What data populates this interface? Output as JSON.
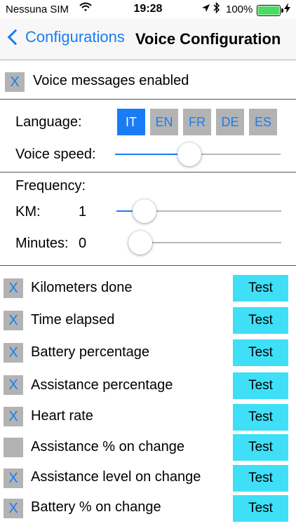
{
  "status_bar": {
    "carrier": "Nessuna SIM",
    "time": "19:28",
    "battery_percent": "100%",
    "battery_level": 1.0
  },
  "nav": {
    "back_label": "Configurations",
    "title": "Voice Configuration"
  },
  "voice_enabled": {
    "label": "Voice messages enabled",
    "checked": true,
    "mark": "X"
  },
  "language": {
    "label": "Language:",
    "options": [
      "IT",
      "EN",
      "FR",
      "DE",
      "ES"
    ],
    "selected": "IT"
  },
  "voice_speed": {
    "label": "Voice speed:",
    "value": 0.45
  },
  "frequency": {
    "label": "Frequency:",
    "km": {
      "label": "KM:",
      "value": "1",
      "slider_value": 0.17
    },
    "minutes": {
      "label": "Minutes:",
      "value": "0",
      "slider_value": 0.0
    }
  },
  "messages": [
    {
      "label": "Kilometers done",
      "checked": true,
      "mark": "X",
      "test_label": "Test"
    },
    {
      "label": "Time elapsed",
      "checked": true,
      "mark": "X",
      "test_label": "Test"
    },
    {
      "label": "Battery percentage",
      "checked": true,
      "mark": "X",
      "test_label": "Test"
    },
    {
      "label": "Assistance percentage",
      "checked": true,
      "mark": "X",
      "test_label": "Test"
    },
    {
      "label": "Heart rate",
      "checked": true,
      "mark": "X",
      "test_label": "Test"
    },
    {
      "label": "Assistance % on change",
      "checked": false,
      "mark": "",
      "test_label": "Test"
    },
    {
      "label": "Assistance level on change",
      "checked": true,
      "mark": "X",
      "test_label": "Test"
    },
    {
      "label": "Battery % on change",
      "checked": true,
      "mark": "X",
      "test_label": "Test"
    }
  ],
  "colors": {
    "accent": "#1a7cf5",
    "checkbox_bg": "#b3b3b3",
    "test_button": "#3fdff7",
    "battery": "#4cd964"
  }
}
